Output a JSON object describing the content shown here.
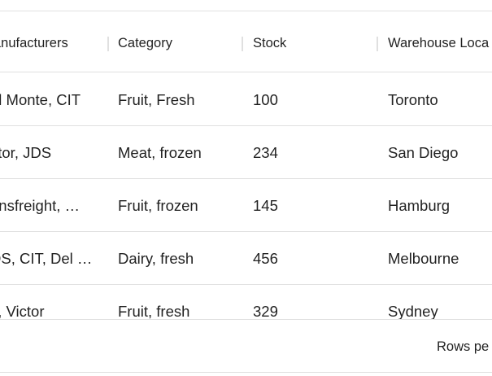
{
  "columns": {
    "manufacturers": "anufacturers",
    "category": "Category",
    "stock": "Stock",
    "warehouse": "Warehouse Loca"
  },
  "rows": [
    {
      "manufacturers": "el Monte, CIT",
      "category": "Fruit, Fresh",
      "stock": "100",
      "warehouse": "Toronto"
    },
    {
      "manufacturers": "ctor, JDS",
      "category": "Meat, frozen",
      "stock": "234",
      "warehouse": "San Diego"
    },
    {
      "manufacturers": "ansfreight, …",
      "category": "Fruit, frozen",
      "stock": "145",
      "warehouse": "Hamburg"
    },
    {
      "manufacturers": "DS, CIT, Del …",
      "category": "Dairy, fresh",
      "stock": "456",
      "warehouse": "Melbourne"
    },
    {
      "manufacturers": "T, Victor",
      "category": "Fruit, fresh",
      "stock": "329",
      "warehouse": "Sydney"
    }
  ],
  "footer": {
    "rows_per_page_label": "Rows pe"
  }
}
